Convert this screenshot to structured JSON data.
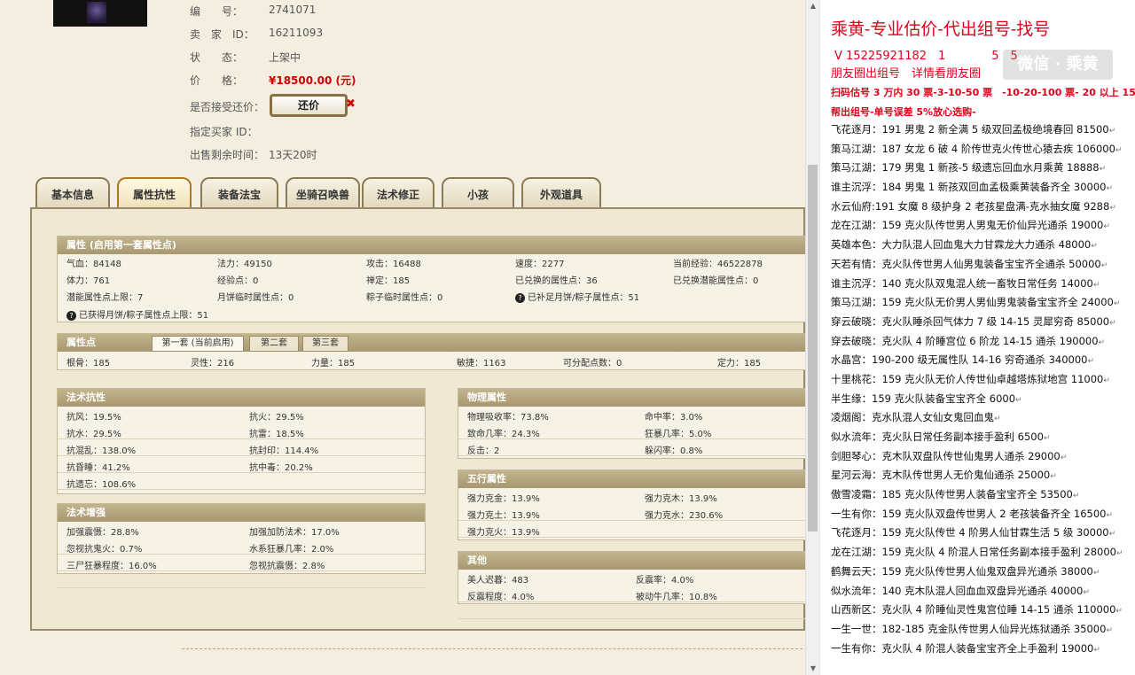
{
  "item": {
    "fields": [
      {
        "label": "编　　号：",
        "value": "2741071"
      },
      {
        "label": "卖　家　ID：",
        "value": "16211093"
      },
      {
        "label": "状　　态：",
        "value": "上架中"
      },
      {
        "label": "价　　格：",
        "value": "¥18500.00 (元)"
      },
      {
        "label": "是否接受还价：",
        "value": ""
      },
      {
        "label": "指定买家 ID：",
        "value": ""
      },
      {
        "label": "出售剩余时间：",
        "value": "13天20时"
      }
    ],
    "counter_offer_label": "还价"
  },
  "tabs": [
    "基本信息",
    "属性抗性",
    "装备法宝",
    "坐骑召唤兽",
    "法术修正",
    "小孩",
    "外观道具"
  ],
  "attributes": {
    "title": "属性 (启用第一套属性点)",
    "rows": [
      [
        "气血：84148",
        "法力：49150",
        "攻击：16488",
        "速度：2277",
        "当前经验：46522878"
      ],
      [
        "体力：761",
        "经验点：0",
        "禅定：185",
        "已兑换的属性点：36",
        "已兑换潜能属性点：0"
      ],
      [
        "潜能属性点上限：7",
        "月饼临时属性点：0",
        "粽子临时属性点：0",
        "已补足月饼/粽子属性点：51",
        ""
      ]
    ],
    "note": "已获得月饼/粽子属性点上限：51"
  },
  "points": {
    "title": "属性点",
    "subtabs": [
      "第一套 (当前启用)",
      "第二套",
      "第三套"
    ],
    "values": [
      "根骨：185",
      "灵性：216",
      "力量：185",
      "敏捷：1163",
      "可分配点数：0",
      "定力：185"
    ]
  },
  "resist": {
    "title": "法术抗性",
    "rows": [
      [
        "抗风：19.5%",
        "抗火：29.5%"
      ],
      [
        "抗水：29.5%",
        "抗雷：18.5%"
      ],
      [
        "抗混乱：138.0%",
        "抗封印：114.4%"
      ],
      [
        "抗昏睡：41.2%",
        "抗中毒：20.2%"
      ],
      [
        "抗遗忘：108.6%",
        ""
      ]
    ]
  },
  "boost": {
    "title": "法术增强",
    "rows": [
      [
        "加强震慑：28.8%",
        "加强加防法术：17.0%"
      ],
      [
        "忽视抗鬼火：0.7%",
        "水系狂暴几率：2.0%"
      ],
      [
        "三尸狂暴程度：16.0%",
        "忽视抗震慑：2.8%"
      ]
    ]
  },
  "physical": {
    "title": "物理属性",
    "rows": [
      [
        "物理吸收率：73.8%",
        "命中率：3.0%"
      ],
      [
        "致命几率：24.3%",
        "狂暴几率：5.0%"
      ],
      [
        "反击：2",
        "躲闪率：0.8%"
      ]
    ]
  },
  "elements": {
    "title": "五行属性",
    "rows": [
      [
        "强力克金：13.9%",
        "强力克木：13.9%"
      ],
      [
        "强力克土：13.9%",
        "强力克水：230.6%"
      ],
      [
        "强力克火：13.9%",
        ""
      ]
    ]
  },
  "other": {
    "title": "其他",
    "rows": [
      [
        "美人迟暮：483",
        "反震率：4.0%"
      ],
      [
        "反震程度：4.0%",
        "被动牛几率：10.8%"
      ]
    ]
  },
  "ad": {
    "headline": "乘黄-专业估价-代出组号-找号",
    "phone": "V 15225921182　1　　　　5　5",
    "line3": "朋友圈出组号　详情看朋友圈",
    "line4": "扫码估号 3 万内 30 票-3-10-50 票　-10-20-100 票- 20 以上 150",
    "line5": "帮出组号-单号误差 5%放心选购-",
    "watermark": "微信 · 乘黄",
    "listings": [
      "飞花逐月：191 男鬼 2 新全满 5 级双回孟极绝境春回 81500",
      "策马江湖：187 女龙 6 破 4 阶传世克火传世心猿去疾 106000",
      "策马江湖：179 男鬼 1 新孩-5 级遗忘回血水月乘黄 18888",
      "谁主沉浮：184 男鬼 1 新孩双回血孟极乘黄装备齐全 30000",
      "水云仙府:191 女魔 8 级护身 2 老孩星盘满-克水抽女魔 9288",
      "龙在江湖：159 克火队传世男人男鬼无价仙异光通杀 19000",
      "英雄本色：大力队混人回血鬼大力甘霖龙大力通杀 48000",
      "天若有情：克火队传世男人仙男鬼装备宝宝齐全通杀 50000",
      "谁主沉浮：140 克火队双鬼混人统一畜牧日常任务 14000",
      "策马江湖：159 克火队无价男人男仙男鬼装备宝宝齐全 24000",
      "穿云破晓：克火队睡杀回气体力 7 级 14-15 灵犀穷奇 85000",
      "穿去破晓：克火队 4 阶睡宫位 6 阶龙 14-15 通杀 190000",
      "水晶宫：190-200 级无属性队 14-16 穷奇通杀 340000",
      "十里桃花：159 克火队无价人传世仙卓越塔炼狱地宫 11000",
      "半生缘：159 克火队装备宝宝齐全 6000",
      "凌烟阁：克水队混人女仙女鬼回血鬼",
      "似水流年：克火队日常任务副本接手盈利 6500",
      "剑胆琴心：克木队双盘队传世仙鬼男人通杀 29000",
      "星河云海：克木队传世男人无价鬼仙通杀 25000",
      "傲雪凌霜：185 克火队传世男人装备宝宝齐全 53500",
      "一生有你：159 克火队双盘传世男人 2 老孩装备齐全 16500",
      "飞花逐月：159 克火队传世 4 阶男人仙甘霖生活 5 级 30000",
      "龙在江湖：159 克火队 4 阶混人日常任务副本接手盈利 28000",
      "鹤舞云天：159 克火队传世男人仙鬼双盘异光通杀 38000",
      "似水流年：140 克木队混人回血血双盘异光通杀 40000",
      "山西新区：克火队 4 阶睡仙灵性鬼宫位睡 14-15 通杀 110000",
      "一生一世：182-185 克金队传世男人仙异光炼狱通杀 35000",
      "一生有你：克火队 4 阶混人装备宝宝齐全上手盈利 19000"
    ]
  }
}
